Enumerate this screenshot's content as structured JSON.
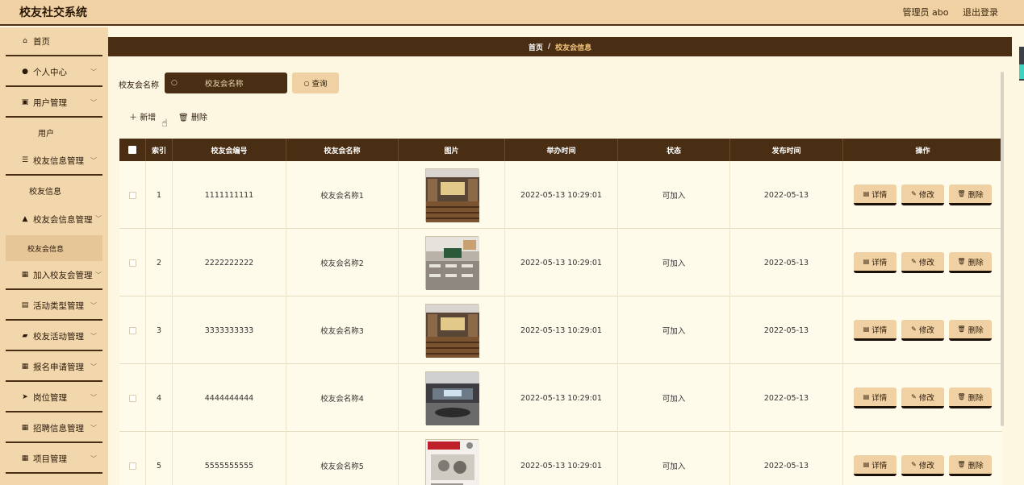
{
  "header": {
    "title": "校友社交系统",
    "user": "管理员 abo",
    "logout": "退出登录"
  },
  "sidebar": {
    "home": "首页",
    "personal": "个人中心",
    "user_mgmt": "用户管理",
    "user_sub": "用户",
    "alumni_info_mgmt": "校友信息管理",
    "alumni_info_sub": "校友信息",
    "assoc_info_mgmt": "校友会信息管理",
    "assoc_info_sub": "校友会信息",
    "join_assoc_mgmt": "加入校友会管理",
    "activity_type_mgmt": "活动类型管理",
    "alumni_activity_mgmt": "校友活动管理",
    "signup_mgmt": "报名申请管理",
    "job_mgmt": "岗位管理",
    "recruit_mgmt": "招聘信息管理",
    "project_mgmt": "项目管理"
  },
  "breadcrumb": {
    "home": "首页",
    "sep": "/",
    "current": "校友会信息"
  },
  "search": {
    "label": "校友会名称",
    "placeholder": "校友会名称",
    "button": "查询"
  },
  "toolbar": {
    "add": "新增",
    "delete": "删除"
  },
  "table": {
    "headers": {
      "index": "索引",
      "code": "校友会编号",
      "name": "校友会名称",
      "image": "图片",
      "hold_time": "举办时间",
      "status": "状态",
      "publish_time": "发布时间",
      "ops": "操作"
    },
    "ops": {
      "detail": "详情",
      "edit": "修改",
      "delete": "删除"
    },
    "rows": [
      {
        "index": "1",
        "code": "1111111111",
        "name": "校友会名称1",
        "hold_time": "2022-05-13 10:29:01",
        "status": "可加入",
        "publish_time": "2022-05-13"
      },
      {
        "index": "2",
        "code": "2222222222",
        "name": "校友会名称2",
        "hold_time": "2022-05-13 10:29:01",
        "status": "可加入",
        "publish_time": "2022-05-13"
      },
      {
        "index": "3",
        "code": "3333333333",
        "name": "校友会名称3",
        "hold_time": "2022-05-13 10:29:01",
        "status": "可加入",
        "publish_time": "2022-05-13"
      },
      {
        "index": "4",
        "code": "4444444444",
        "name": "校友会名称4",
        "hold_time": "2022-05-13 10:29:01",
        "status": "可加入",
        "publish_time": "2022-05-13"
      },
      {
        "index": "5",
        "code": "5555555555",
        "name": "校友会名称5",
        "hold_time": "2022-05-13 10:29:01",
        "status": "可加入",
        "publish_time": "2022-05-13"
      }
    ]
  },
  "icons": {
    "home": "home-icon",
    "user": "user-icon",
    "search": "search-icon",
    "add": "plus-icon",
    "trash": "trash-icon",
    "detail": "document-icon",
    "edit": "pencil-icon"
  },
  "colors": {
    "accent_dark": "#4a2e14",
    "accent_light": "#f0d1a3",
    "background": "#fdf7e2"
  }
}
